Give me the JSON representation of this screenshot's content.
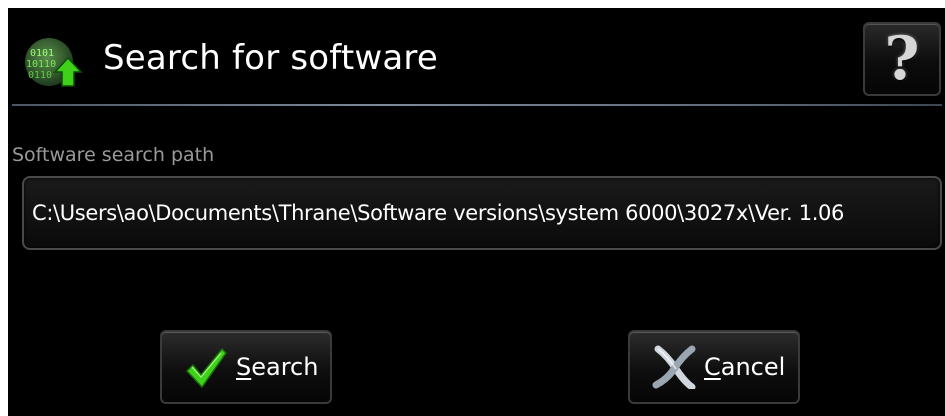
{
  "dialog": {
    "title": "Search for software",
    "help_label": "?"
  },
  "field": {
    "label": "Software search path",
    "value": "C:\\Users\\ao\\Documents\\Thrane\\Software versions\\system 6000\\3027x\\Ver. 1.06"
  },
  "buttons": {
    "search": {
      "accel": "S",
      "rest": "earch"
    },
    "cancel": {
      "accel": "C",
      "rest": "ancel"
    }
  },
  "icons": {
    "app": "binary-globe-upload-icon",
    "search": "checkmark-icon",
    "cancel": "cross-icon",
    "help": "question-mark-icon"
  },
  "colors": {
    "background": "#000000",
    "text": "#ffffff",
    "label": "#9a9a9a",
    "divider": "#6b7a88",
    "accent_green": "#3fd11a"
  }
}
